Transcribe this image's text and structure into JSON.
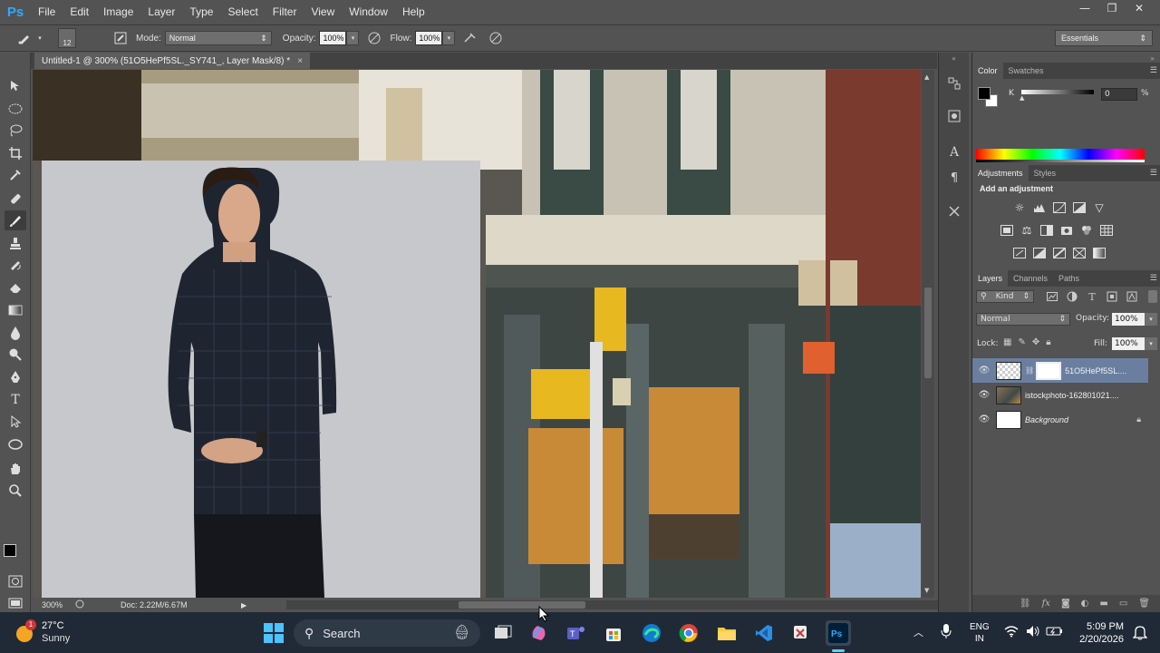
{
  "app": {
    "logo": "Ps"
  },
  "menu": [
    "File",
    "Edit",
    "Image",
    "Layer",
    "Type",
    "Select",
    "Filter",
    "View",
    "Window",
    "Help"
  ],
  "window_controls": {
    "minimize": "—",
    "restore": "❐",
    "close": "✕"
  },
  "options": {
    "brush_size": "12",
    "mode_label": "Mode:",
    "mode_value": "Normal",
    "opacity_label": "Opacity:",
    "opacity_value": "100%",
    "flow_label": "Flow:",
    "flow_value": "100%",
    "workspace": "Essentials"
  },
  "document": {
    "tab_title": "Untitled-1 @ 300% (51O5HePf5SL._SY741_, Layer Mask/8) *",
    "tab_close": "×"
  },
  "status": {
    "zoom": "300%",
    "doc": "Doc: 2.22M/6.67M"
  },
  "toolbar_icons": [
    "move-icon",
    "marquee-icon",
    "lasso-icon",
    "crop-icon",
    "eyedropper-icon",
    "healing-icon",
    "brush-icon",
    "stamp-icon",
    "history-brush-icon",
    "eraser-icon",
    "gradient-icon",
    "blur-icon",
    "dodge-icon",
    "pen-icon",
    "type-icon",
    "path-select-icon",
    "shape-icon",
    "hand-icon",
    "zoom-icon"
  ],
  "color_panel": {
    "tabs": [
      "Color",
      "Swatches"
    ],
    "channel_label": "K",
    "value": "0",
    "unit": "%"
  },
  "adjustments_panel": {
    "tabs": [
      "Adjustments",
      "Styles"
    ],
    "heading": "Add an adjustment"
  },
  "layers_panel": {
    "tabs": [
      "Layers",
      "Channels",
      "Paths"
    ],
    "filter_kind": "Kind",
    "blend_mode": "Normal",
    "opacity_label": "Opacity:",
    "opacity_value": "100%",
    "lock_label": "Lock:",
    "fill_label": "Fill:",
    "fill_value": "100%",
    "layers": [
      {
        "name": "51O5HePf5SL....",
        "selected": true
      },
      {
        "name": "istockphoto-162801021....",
        "selected": false
      },
      {
        "name": "Background",
        "selected": false
      }
    ]
  },
  "taskbar": {
    "weather_temp": "27°C",
    "weather_desc": "Sunny",
    "weather_badge": "1",
    "search": "Search",
    "lang_line1": "ENG",
    "lang_line2": "IN",
    "time": "5:09 PM",
    "date": "2/20/2026"
  },
  "colors": {
    "ps_accent": "#31a8ff",
    "selected_layer": "#6a7fa0",
    "taskbar_bg": "#202a36"
  }
}
